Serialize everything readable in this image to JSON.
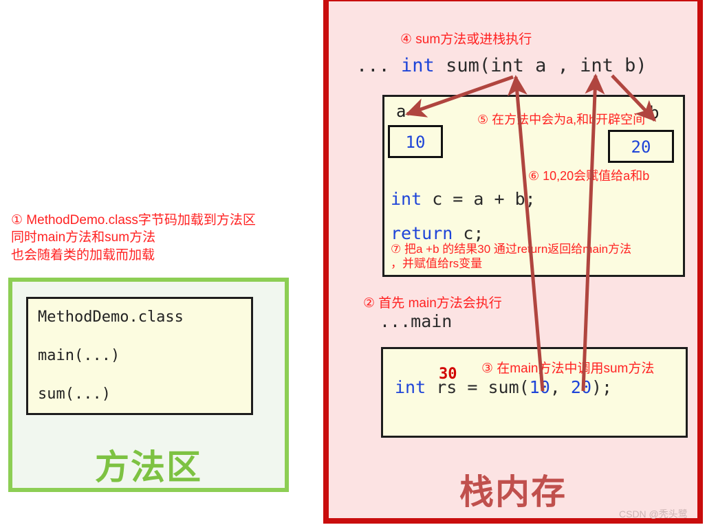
{
  "colors": {
    "stack_border": "#c90d0d",
    "stack_fill": "#fce3e3",
    "method_area_border": "#8dce54",
    "method_area_fill": "#f1f7ef",
    "code_box_fill": "#fcfce0",
    "code_box_border": "#1d1d1d",
    "note_red": "#ff2222",
    "keyword_blue": "#1e44d8",
    "method_area_label": "#7dc242",
    "stack_label": "#c0504d",
    "arrow": "#b0453f",
    "result_red": "#d10000"
  },
  "method_area": {
    "note": "① MethodDemo.class字节码加载到方法区\n同时main方法和sum方法\n也会随着类的加载而加载",
    "label": "方法区",
    "class_box": {
      "line1": "MethodDemo.class",
      "line2": "main(...)",
      "line3": "sum(...)"
    }
  },
  "stack": {
    "label": "栈内存",
    "watermark": "CSDN @秃头鹭",
    "notes": {
      "n2": "② 首先 main方法会执行",
      "n3": "③ 在main方法中调用sum方法",
      "n4": "④ sum方法或进栈执行",
      "n5": "⑤ 在方法中会为a,和b开辟空间",
      "n6": "⑥ 10,20会赋值给a和b",
      "n7": "⑦ 把a +b 的结果30 通过return返回给main方法\n，并赋值给rs变量"
    },
    "sum_frame": {
      "signature_dots": "... ",
      "signature_kw": "int",
      "signature_rest": " sum(int a , int b)",
      "var_a_label": "a",
      "var_a_value": "10",
      "var_b_label": "b",
      "var_b_value": "20",
      "line_c_kw": "int",
      "line_c_rest": " c = a + b;",
      "line_return_kw": "return",
      "line_return_rest": " c;"
    },
    "main_frame": {
      "header": "...main",
      "result_value": "30",
      "call_kw": "int",
      "call_mid": " rs = sum(",
      "call_arg1": "10",
      "call_sep": ", ",
      "call_arg2": "20",
      "call_end": ");"
    }
  }
}
